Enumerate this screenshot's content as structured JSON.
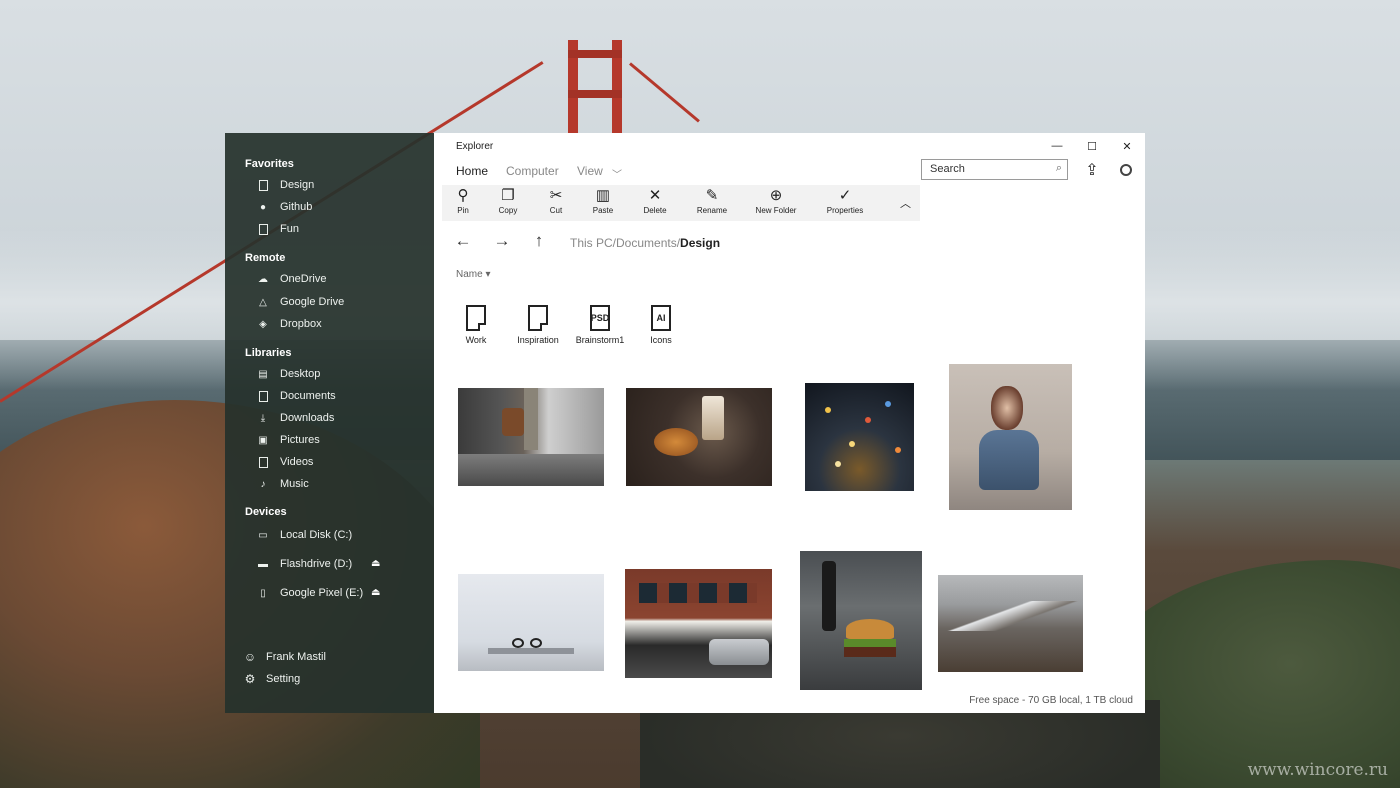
{
  "window": {
    "title": "Explorer",
    "controls": {
      "minimize": "—",
      "maximize": "☐",
      "close": "✕"
    }
  },
  "menu": {
    "home": "Home",
    "computer": "Computer",
    "view": "View"
  },
  "search": {
    "placeholder": "Search"
  },
  "ribbon": {
    "pin": "Pin",
    "copy": "Copy",
    "cut": "Cut",
    "paste": "Paste",
    "delete": "Delete",
    "rename": "Rename",
    "new_folder": "New Folder",
    "properties": "Properties"
  },
  "breadcrumb": {
    "path": "This PC/Documents/",
    "current": "Design"
  },
  "sort": {
    "label": "Name"
  },
  "sidebar": {
    "favorites": {
      "title": "Favorites",
      "items": [
        "Design",
        "Github",
        "Fun"
      ]
    },
    "remote": {
      "title": "Remote",
      "items": [
        "OneDrive",
        "Google Drive",
        "Dropbox"
      ]
    },
    "libraries": {
      "title": "Libraries",
      "items": [
        "Desktop",
        "Documents",
        "Downloads",
        "Pictures",
        "Videos",
        "Music"
      ]
    },
    "devices": {
      "title": "Devices",
      "items": [
        "Local Disk (C:)",
        "Flashdrive (D:)",
        "Google Pixel (E:)"
      ]
    },
    "user": "Frank Mastil",
    "setting": "Setting"
  },
  "folders": [
    {
      "name": "Work",
      "badge": ""
    },
    {
      "name": "Inspiration",
      "badge": ""
    },
    {
      "name": "Brainstorm1",
      "badge": "PSD"
    },
    {
      "name": "Icons",
      "badge": "AI"
    }
  ],
  "status": "Free space - 70 GB local, 1 TB cloud",
  "watermark": "www.wincore.ru"
}
